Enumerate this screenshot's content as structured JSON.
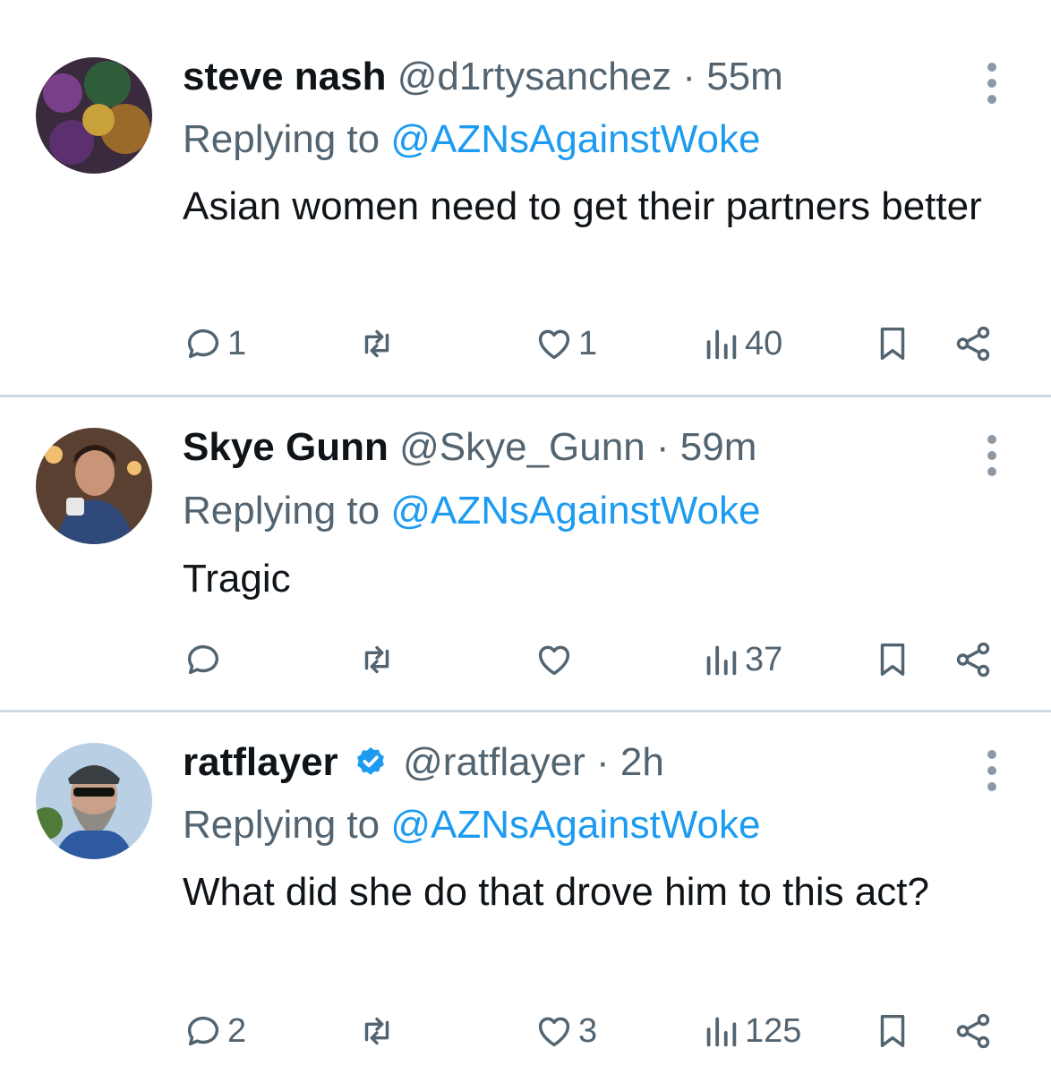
{
  "tweets": [
    {
      "name": "steve nash",
      "handle": "@d1rtysanchez",
      "separator": "·",
      "time": "55m",
      "replying_prefix": "Replying to",
      "replying_to": "@AZNsAgainstWoke",
      "text": "Asian women need to get their partners better",
      "reply_count": "1",
      "retweet_count": "",
      "like_count": "1",
      "views": "40",
      "verified": false
    },
    {
      "name": "Skye Gunn",
      "handle": "@Skye_Gunn",
      "separator": "·",
      "time": "59m",
      "replying_prefix": "Replying to",
      "replying_to": "@AZNsAgainstWoke",
      "text": "Tragic",
      "reply_count": "",
      "retweet_count": "",
      "like_count": "",
      "views": "37",
      "verified": false
    },
    {
      "name": "ratflayer",
      "handle": "@ratflayer",
      "separator": "·",
      "time": "2h",
      "replying_prefix": "Replying to",
      "replying_to": "@AZNsAgainstWoke",
      "text": "What did she do that drove him to this act?",
      "reply_count": "2",
      "retweet_count": "",
      "like_count": "3",
      "views": "125",
      "verified": true
    }
  ],
  "colors": {
    "text": "#0f1419",
    "secondary": "#536471",
    "link": "#1d9bf0",
    "divider": "#cfd9de",
    "verified": "#1d9bf0"
  },
  "icons": [
    "reply-icon",
    "retweet-icon",
    "like-icon",
    "views-icon",
    "bookmark-icon",
    "share-icon",
    "more-icon",
    "verified-badge-icon"
  ]
}
